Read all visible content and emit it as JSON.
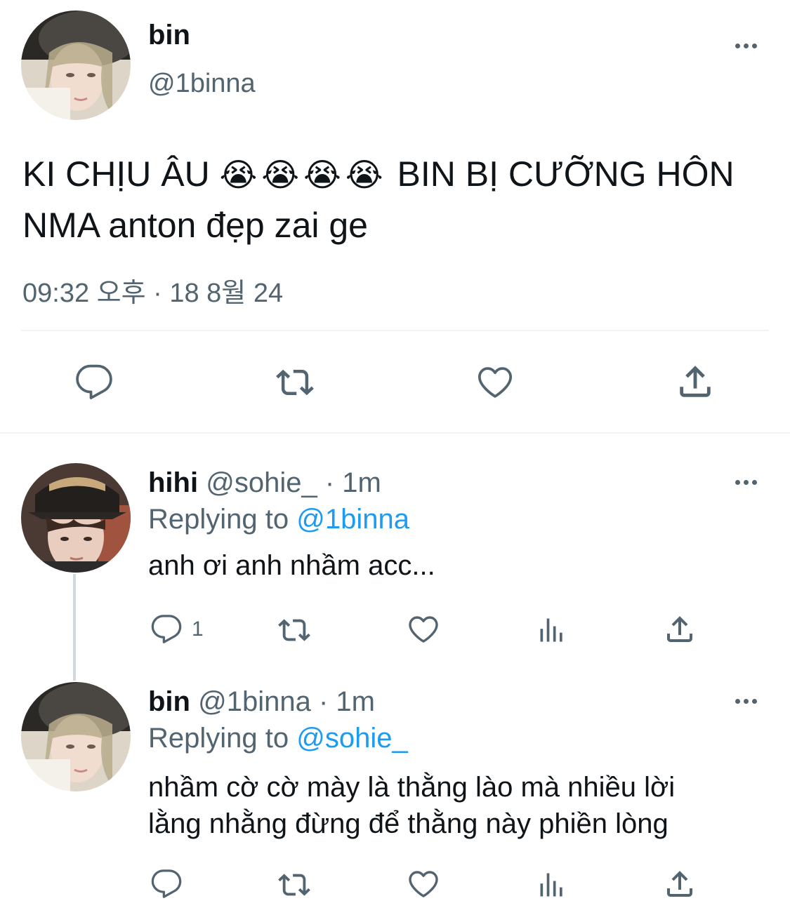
{
  "main_tweet": {
    "display_name": "bin",
    "handle": "@1binna",
    "text_line1": "KI CHỊU ÂU",
    "emoji": "😭😭😭😭",
    "text_line1_rest": "BIN BỊ CƯỠNG HÔN",
    "text_line2": "NMA anton đẹp zai ge",
    "timestamp": "09:32 오후 · 18 8월 24"
  },
  "replies": [
    {
      "display_name": "hihi",
      "handle": "@sohie_",
      "separator": "·",
      "time": "1m",
      "replying_to_label": "Replying to",
      "replying_to_handle": "@1binna",
      "text_lines": [
        "anh ơi anh nhầm acc..."
      ],
      "reply_count": "1"
    },
    {
      "display_name": "bin",
      "handle": "@1binna",
      "separator": "·",
      "time": "1m",
      "replying_to_label": "Replying to",
      "replying_to_handle": "@sohie_",
      "text_lines": [
        "nhầm cờ cờ mày là thằng lào mà nhiều lời",
        "lằng nhằng đừng để thằng này phiền lòng"
      ],
      "reply_count": ""
    }
  ],
  "icons": {
    "reply": "reply-icon",
    "retweet": "retweet-icon",
    "like": "like-icon",
    "share": "share-icon",
    "views": "views-icon",
    "more": "more-icon"
  },
  "colors": {
    "text": "#0f1419",
    "secondary": "#536471",
    "link": "#1d9bf0",
    "divider": "#eff3f4"
  }
}
